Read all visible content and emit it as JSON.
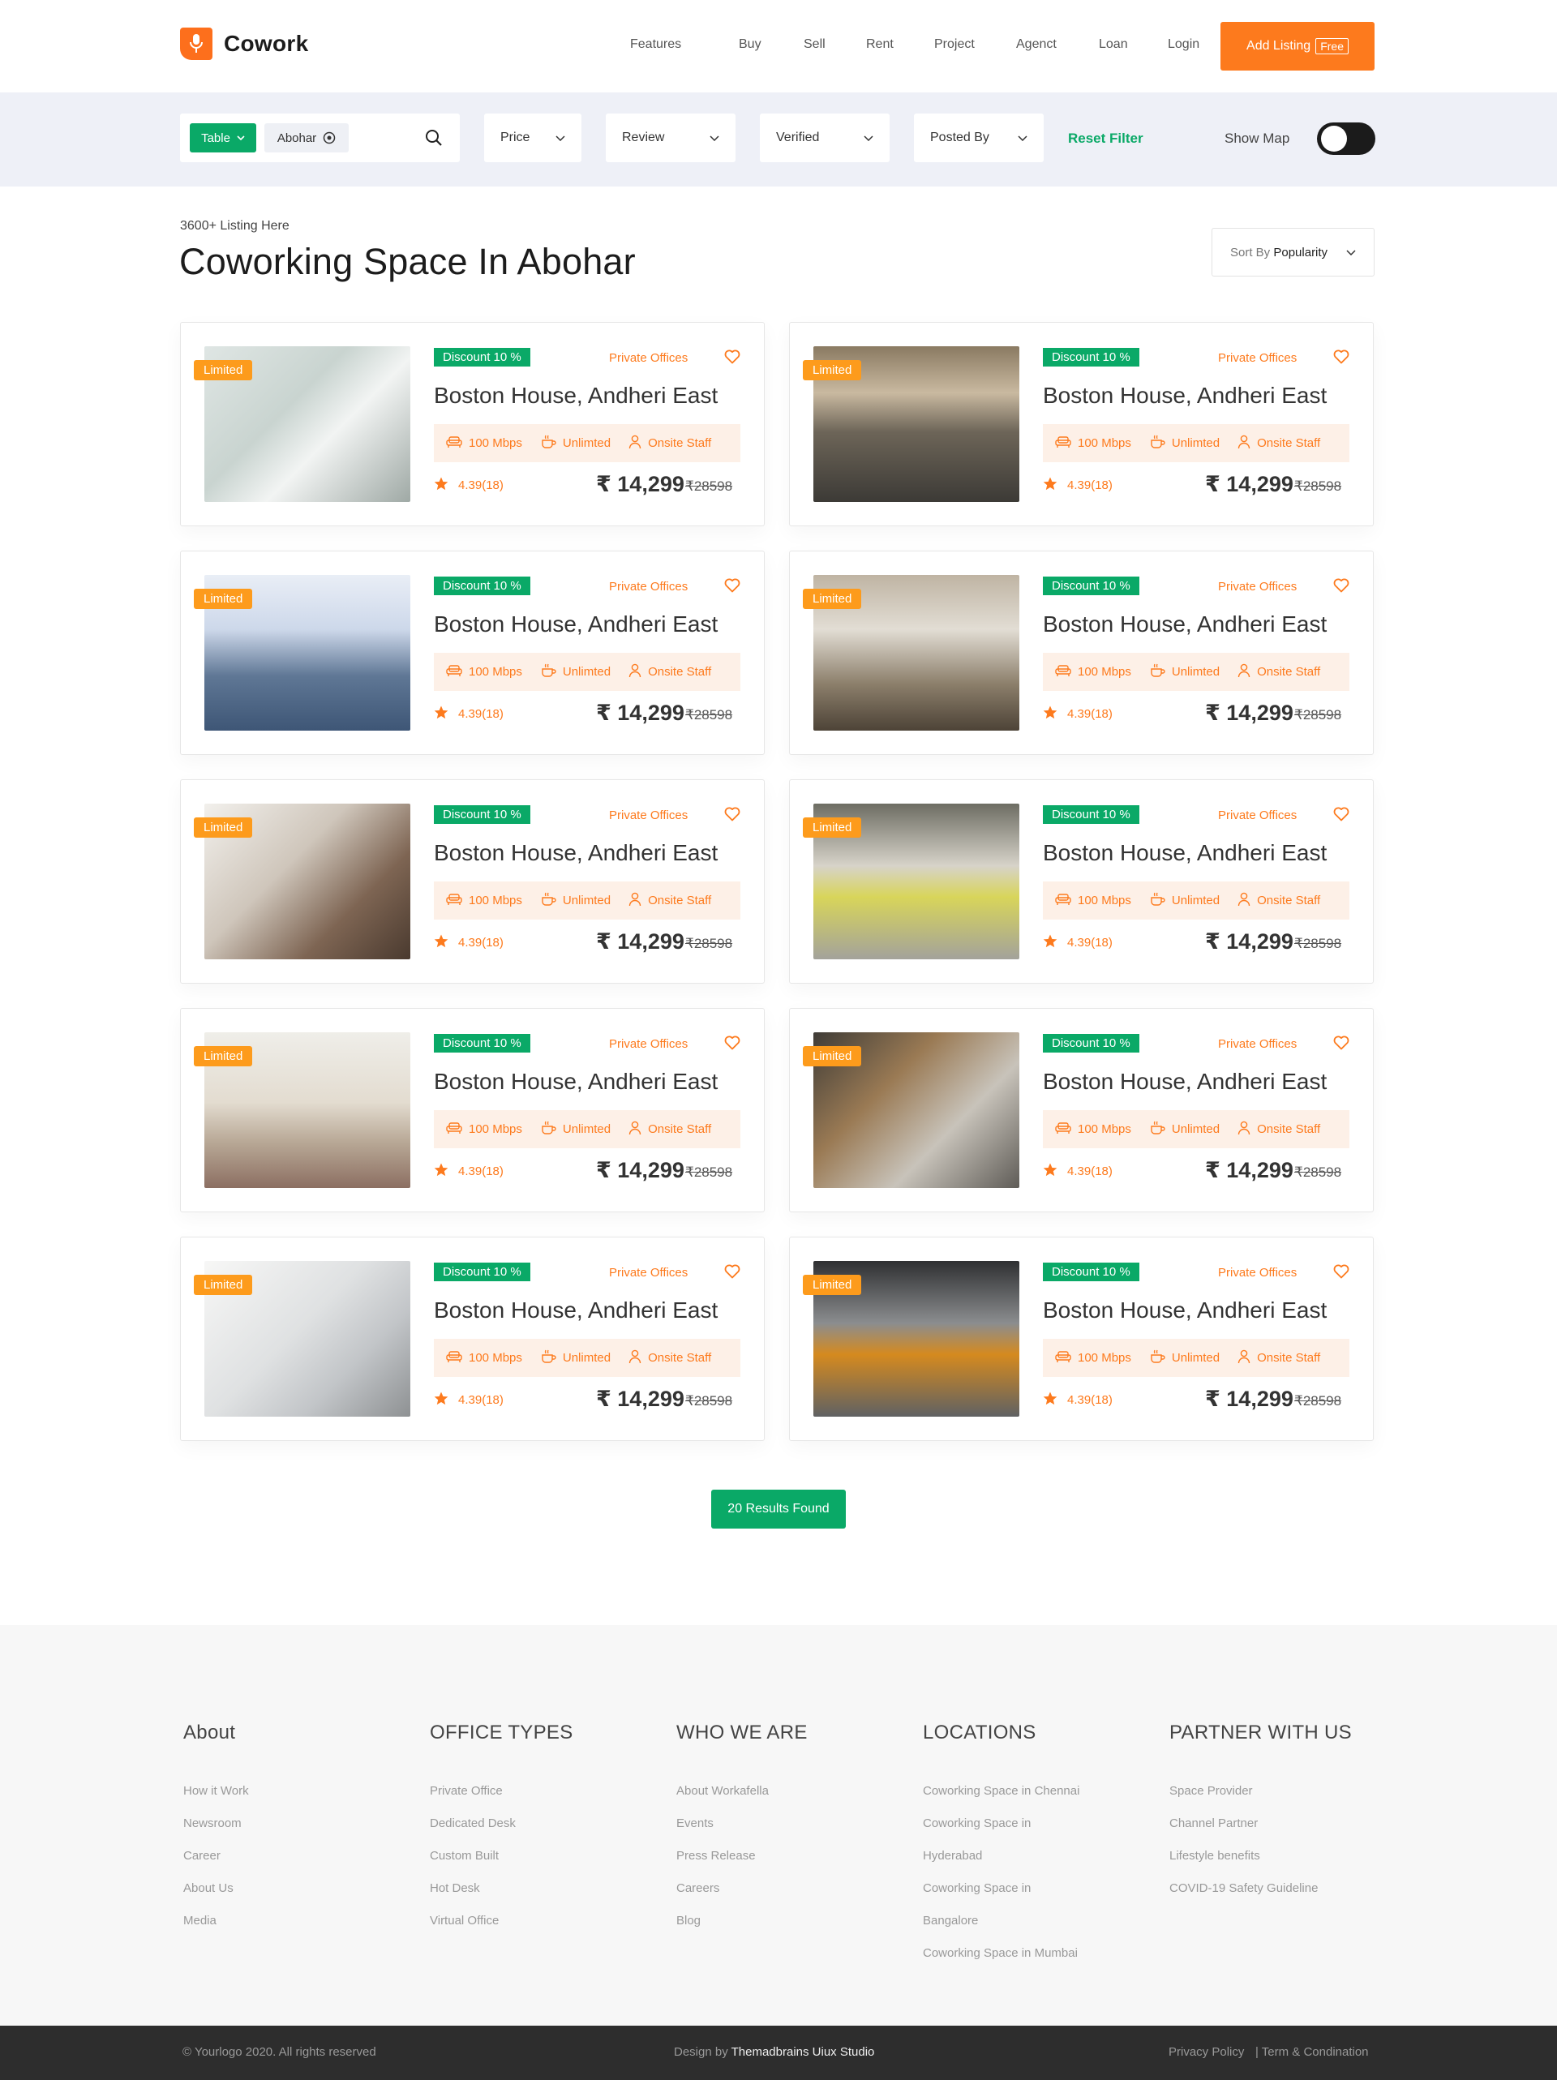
{
  "brand": {
    "name": "Cowork",
    "accent": "#fd7a1d",
    "green": "#0aa967"
  },
  "nav": {
    "items": [
      "Features",
      "Buy",
      "Sell",
      "Rent",
      "Project",
      "Agenct",
      "Loan",
      "Login"
    ],
    "cta_label": "Add Listing",
    "cta_tag": "Free"
  },
  "filters": {
    "type_chip": "Table",
    "location_chip": "Abohar",
    "dropdowns": [
      "Price",
      "Review",
      "Verified",
      "Posted By"
    ],
    "reset_label": "Reset Filter",
    "show_map_label": "Show Map",
    "show_map_on": true
  },
  "listing": {
    "count_text": "3600+ Listing Here",
    "title": "Coworking Space In Abohar",
    "sort_prefix": "Sort By",
    "sort_value": "Popularity"
  },
  "card_template": {
    "badge": "Limited",
    "discount": "Discount 10 %",
    "type": "Private Offices",
    "name": "Boston House, Andheri East",
    "amenity_1": "100 Mbps",
    "amenity_2": "Unlimted",
    "amenity_3": "Onsite Staff",
    "rating": "4.39(18)",
    "price": "₹ 14,299",
    "old_price": "₹28598"
  },
  "cards_count": 10,
  "results_label": "20 Results Found",
  "footer": {
    "columns": [
      {
        "heading": "About",
        "links": [
          "How it Work",
          "Newsroom",
          "Career",
          "About Us",
          "Media"
        ]
      },
      {
        "heading": "OFFICE TYPES",
        "links": [
          "Private Office",
          "Dedicated Desk",
          "Custom Built",
          "Hot Desk",
          "Virtual Office"
        ]
      },
      {
        "heading": "WHO WE ARE",
        "links": [
          "About Workafella",
          "Events",
          "Press Release",
          "Careers",
          "Blog"
        ]
      },
      {
        "heading": "LOCATIONS",
        "links": [
          "Coworking Space in Chennai",
          "Coworking Space in",
          "Hyderabad",
          "Coworking Space in",
          "Bangalore",
          "Coworking Space in Mumbai"
        ]
      },
      {
        "heading": "PARTNER WITH US",
        "links": [
          "Space Provider",
          "Channel Partner",
          "Lifestyle benefits",
          "COVID-19 Safety Guideline"
        ]
      }
    ],
    "copyright": "© Yourlogo 2020. All rights reserved",
    "design_prefix": "Design by",
    "design_by": "Themadbrains Uiux Studio",
    "privacy": "Privacy Policy",
    "terms": "| Term & Condination"
  }
}
